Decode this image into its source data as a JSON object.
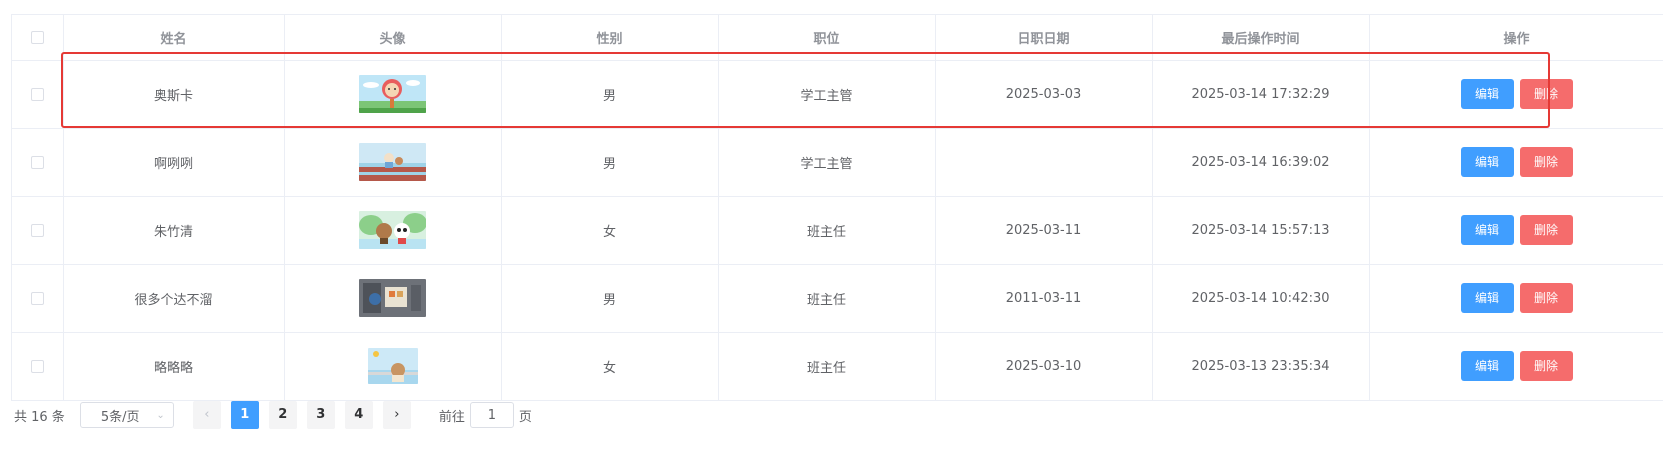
{
  "table": {
    "columns": [
      "姓名",
      "头像",
      "性别",
      "职位",
      "日职日期",
      "最后操作时间",
      "操作"
    ],
    "rows": [
      {
        "name": "奥斯卡",
        "avatar": "avatar-image",
        "gender": "男",
        "position": "学工主管",
        "entry_date": "2025-03-03",
        "last_op": "2025-03-14 17:32:29"
      },
      {
        "name": "啊咧咧",
        "avatar": "avatar-image",
        "gender": "男",
        "position": "学工主管",
        "entry_date": "",
        "last_op": "2025-03-14 16:39:02"
      },
      {
        "name": "朱竹清",
        "avatar": "avatar-image",
        "gender": "女",
        "position": "班主任",
        "entry_date": "2025-03-11",
        "last_op": "2025-03-14 15:57:13"
      },
      {
        "name": "很多个达不溜",
        "avatar": "avatar-image",
        "gender": "男",
        "position": "班主任",
        "entry_date": "2011-03-11",
        "last_op": "2025-03-14 10:42:30"
      },
      {
        "name": "略略略",
        "avatar": "avatar-image",
        "gender": "女",
        "position": "班主任",
        "entry_date": "2025-03-10",
        "last_op": "2025-03-13 23:35:34"
      }
    ],
    "edit_label": "编辑",
    "delete_label": "删除",
    "highlight_color": "#e53935",
    "edit_color": "#409eff",
    "delete_color": "#f56c6c"
  },
  "pagination": {
    "total_label": "共 16 条",
    "page_size": "5条/页",
    "pages": [
      "1",
      "2",
      "3",
      "4"
    ],
    "current_page": "1",
    "prev_icon": "chevron-left-icon",
    "next_icon": "chevron-right-icon",
    "goto_prefix": "前往",
    "goto_value": "1",
    "goto_suffix": "页"
  }
}
